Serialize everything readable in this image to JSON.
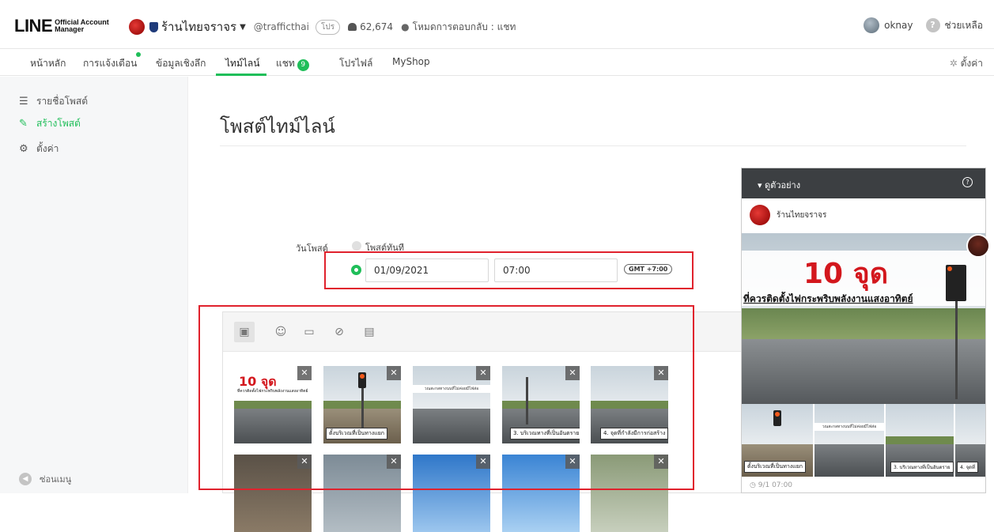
{
  "brand": {
    "main": "LINE",
    "sub_line1": "Official Account",
    "sub_line2": "Manager"
  },
  "account": {
    "name": "ร้านไทยจราจร",
    "handle": "@trafficthai",
    "plan_badge": "โปร",
    "followers": "62,674",
    "reply_mode": "โหมดการตอบกลับ : แชท"
  },
  "user": {
    "name": "oknay",
    "help_label": "ช่วยเหลือ"
  },
  "nav": {
    "items": [
      "หน้าหลัก",
      "การแจ้งเตือน",
      "ข้อมูลเชิงลึก",
      "ไทม์ไลน์",
      "แชท",
      "โปรไฟล์",
      "MyShop"
    ],
    "active": "ไทม์ไลน์",
    "chat_badge": "9",
    "settings_label": "ตั้งค่า"
  },
  "sidebar": {
    "items": [
      {
        "label": "รายชื่อโพสต์",
        "icon": "list-icon"
      },
      {
        "label": "สร้างโพสต์",
        "icon": "edit-icon"
      },
      {
        "label": "ตั้งค่า",
        "icon": "gear-icon"
      }
    ],
    "collapse_label": "ซ่อนเมนู"
  },
  "main": {
    "title": "โพสต์ไทม์ไลน์",
    "post_date_label": "วันโพสต์",
    "post_now_label": "โพสต์ทันที",
    "date_value": "01/09/2021",
    "time_value": "07:00",
    "timezone": "GMT +7:00",
    "toolbar_icons": [
      "photo-icon",
      "emoji-icon",
      "video-icon",
      "link-icon",
      "note-icon"
    ],
    "thumb_captions": [
      "10 จุด",
      "ตั้งบริเวณที่เป็นทางแยก",
      "วณสะกลทางนนที่ไม่ค่อยมีไฟส่อ",
      "3. บริเวณทางที่เป็นอันตราย",
      "4. จุดที่กำลังมีการก่อสร้าง"
    ],
    "thumb_sub": "ที่ควรติดตั้งไฟกระพริบพลังงานแสงอาทิตย์"
  },
  "preview": {
    "title": "ดูตัวอย่าง",
    "account_name": "ร้านไทยจราจร",
    "hero_number": "10 จุด",
    "hero_sub": "ที่ควรติดตั้งไฟกระพริบพลังงานแสงอาทิตย์",
    "strip_captions": [
      "ตั้งบริเวณที่เป็นทางแยก",
      "วณสะกลทางนนที่ไม่ค่อยมีไฟส่อ",
      "3. บริเวณทางที่เป็นอันตราย",
      "4. จุดที่"
    ],
    "timestamp": "9/1 07:00"
  },
  "colors": {
    "accent": "#1fbe59",
    "highlight": "#e0222d",
    "dark_header": "#3c3f42"
  }
}
